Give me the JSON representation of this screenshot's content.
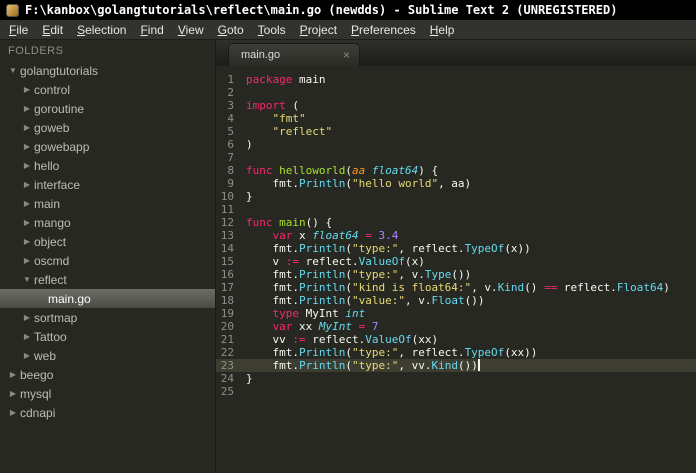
{
  "window": {
    "title": "F:\\kanbox\\golangtutorials\\reflect\\main.go (newdds) - Sublime Text 2 (UNREGISTERED)"
  },
  "menu": {
    "items": [
      "File",
      "Edit",
      "Selection",
      "Find",
      "View",
      "Goto",
      "Tools",
      "Project",
      "Preferences",
      "Help"
    ]
  },
  "sidebar": {
    "header": "FOLDERS",
    "tree": [
      {
        "label": "golangtutorials",
        "level": 0,
        "arrow": "down"
      },
      {
        "label": "control",
        "level": 1,
        "arrow": "right"
      },
      {
        "label": "goroutine",
        "level": 1,
        "arrow": "right"
      },
      {
        "label": "goweb",
        "level": 1,
        "arrow": "right"
      },
      {
        "label": "gowebapp",
        "level": 1,
        "arrow": "right"
      },
      {
        "label": "hello",
        "level": 1,
        "arrow": "right"
      },
      {
        "label": "interface",
        "level": 1,
        "arrow": "right"
      },
      {
        "label": "main",
        "level": 1,
        "arrow": "right"
      },
      {
        "label": "mango",
        "level": 1,
        "arrow": "right"
      },
      {
        "label": "object",
        "level": 1,
        "arrow": "right"
      },
      {
        "label": "oscmd",
        "level": 1,
        "arrow": "right"
      },
      {
        "label": "reflect",
        "level": 1,
        "arrow": "down"
      },
      {
        "label": "main.go",
        "level": 2,
        "arrow": "none",
        "selected": true
      },
      {
        "label": "sortmap",
        "level": 1,
        "arrow": "right"
      },
      {
        "label": "Tattoo",
        "level": 1,
        "arrow": "right"
      },
      {
        "label": "web",
        "level": 1,
        "arrow": "right"
      },
      {
        "label": "beego",
        "level": 0,
        "arrow": "right"
      },
      {
        "label": "mysql",
        "level": 0,
        "arrow": "right"
      },
      {
        "label": "cdnapi",
        "level": 0,
        "arrow": "right"
      }
    ]
  },
  "editor": {
    "tab": {
      "label": "main.go",
      "close_glyph": "×"
    },
    "lines": [
      {
        "n": 1,
        "seg": [
          [
            "k",
            "package"
          ],
          [
            "p",
            " main"
          ]
        ]
      },
      {
        "n": 2,
        "seg": []
      },
      {
        "n": 3,
        "seg": [
          [
            "k",
            "import"
          ],
          [
            "p",
            " ("
          ]
        ]
      },
      {
        "n": 4,
        "seg": [
          [
            "p",
            "    "
          ],
          [
            "s",
            "\"fmt\""
          ]
        ]
      },
      {
        "n": 5,
        "seg": [
          [
            "p",
            "    "
          ],
          [
            "s",
            "\"reflect\""
          ]
        ]
      },
      {
        "n": 6,
        "seg": [
          [
            "p",
            ")"
          ]
        ]
      },
      {
        "n": 7,
        "seg": []
      },
      {
        "n": 8,
        "seg": [
          [
            "k",
            "func"
          ],
          [
            "p",
            " "
          ],
          [
            "fn",
            "helloworld"
          ],
          [
            "p",
            "("
          ],
          [
            "par",
            "aa"
          ],
          [
            "p",
            " "
          ],
          [
            "t",
            "float64"
          ],
          [
            "p",
            ") {"
          ]
        ]
      },
      {
        "n": 9,
        "seg": [
          [
            "p",
            "    fmt."
          ],
          [
            "c",
            "Println"
          ],
          [
            "p",
            "("
          ],
          [
            "s",
            "\"hello world\""
          ],
          [
            "p",
            ", aa)"
          ]
        ]
      },
      {
        "n": 10,
        "seg": [
          [
            "p",
            "}"
          ]
        ]
      },
      {
        "n": 11,
        "seg": []
      },
      {
        "n": 12,
        "seg": [
          [
            "k",
            "func"
          ],
          [
            "p",
            " "
          ],
          [
            "fn",
            "main"
          ],
          [
            "p",
            "() {"
          ]
        ]
      },
      {
        "n": 13,
        "seg": [
          [
            "p",
            "    "
          ],
          [
            "k",
            "var"
          ],
          [
            "p",
            " x "
          ],
          [
            "t",
            "float64"
          ],
          [
            "p",
            " "
          ],
          [
            "k",
            "="
          ],
          [
            "p",
            " "
          ],
          [
            "num",
            "3.4"
          ]
        ]
      },
      {
        "n": 14,
        "seg": [
          [
            "p",
            "    fmt."
          ],
          [
            "c",
            "Println"
          ],
          [
            "p",
            "("
          ],
          [
            "s",
            "\"type:\""
          ],
          [
            "p",
            ", reflect."
          ],
          [
            "c",
            "TypeOf"
          ],
          [
            "p",
            "(x))"
          ]
        ]
      },
      {
        "n": 15,
        "seg": [
          [
            "p",
            "    v "
          ],
          [
            "k",
            ":="
          ],
          [
            "p",
            " reflect."
          ],
          [
            "c",
            "ValueOf"
          ],
          [
            "p",
            "(x)"
          ]
        ]
      },
      {
        "n": 16,
        "seg": [
          [
            "p",
            "    fmt."
          ],
          [
            "c",
            "Println"
          ],
          [
            "p",
            "("
          ],
          [
            "s",
            "\"type:\""
          ],
          [
            "p",
            ", v."
          ],
          [
            "c",
            "Type"
          ],
          [
            "p",
            "())"
          ]
        ]
      },
      {
        "n": 17,
        "seg": [
          [
            "p",
            "    fmt."
          ],
          [
            "c",
            "Println"
          ],
          [
            "p",
            "("
          ],
          [
            "s",
            "\"kind is float64:\""
          ],
          [
            "p",
            ", v."
          ],
          [
            "c",
            "Kind"
          ],
          [
            "p",
            "() "
          ],
          [
            "k",
            "=="
          ],
          [
            "p",
            " reflect."
          ],
          [
            "c",
            "Float64"
          ],
          [
            "p",
            ")"
          ]
        ]
      },
      {
        "n": 18,
        "seg": [
          [
            "p",
            "    fmt."
          ],
          [
            "c",
            "Println"
          ],
          [
            "p",
            "("
          ],
          [
            "s",
            "\"value:\""
          ],
          [
            "p",
            ", v."
          ],
          [
            "c",
            "Float"
          ],
          [
            "p",
            "())"
          ]
        ]
      },
      {
        "n": 19,
        "seg": [
          [
            "p",
            "    "
          ],
          [
            "k",
            "type"
          ],
          [
            "p",
            " MyInt "
          ],
          [
            "t",
            "int"
          ]
        ]
      },
      {
        "n": 20,
        "seg": [
          [
            "p",
            "    "
          ],
          [
            "k",
            "var"
          ],
          [
            "p",
            " xx "
          ],
          [
            "t",
            "MyInt"
          ],
          [
            "p",
            " "
          ],
          [
            "k",
            "="
          ],
          [
            "p",
            " "
          ],
          [
            "num",
            "7"
          ]
        ]
      },
      {
        "n": 21,
        "seg": [
          [
            "p",
            "    vv "
          ],
          [
            "k",
            ":="
          ],
          [
            "p",
            " reflect."
          ],
          [
            "c",
            "ValueOf"
          ],
          [
            "p",
            "(xx)"
          ]
        ]
      },
      {
        "n": 22,
        "seg": [
          [
            "p",
            "    fmt."
          ],
          [
            "c",
            "Println"
          ],
          [
            "p",
            "("
          ],
          [
            "s",
            "\"type:\""
          ],
          [
            "p",
            ", reflect."
          ],
          [
            "c",
            "TypeOf"
          ],
          [
            "p",
            "(xx))"
          ]
        ]
      },
      {
        "n": 23,
        "seg": [
          [
            "p",
            "    fmt."
          ],
          [
            "c",
            "Println"
          ],
          [
            "p",
            "("
          ],
          [
            "s",
            "\"type:\""
          ],
          [
            "p",
            ", vv."
          ],
          [
            "c",
            "Kind"
          ],
          [
            "p",
            "())"
          ]
        ],
        "current": true,
        "cursor": true
      },
      {
        "n": 24,
        "seg": [
          [
            "p",
            "}"
          ]
        ]
      },
      {
        "n": 25,
        "seg": []
      }
    ]
  },
  "colors": {
    "editor_background": "#272822",
    "keyword": "#f92672",
    "string": "#e6db74",
    "function_name": "#a6e22e",
    "type": "#66d9ef",
    "number": "#ae81ff",
    "parameter": "#fd971f",
    "line_number": "#8f908a",
    "current_line": "#3e3d32"
  }
}
